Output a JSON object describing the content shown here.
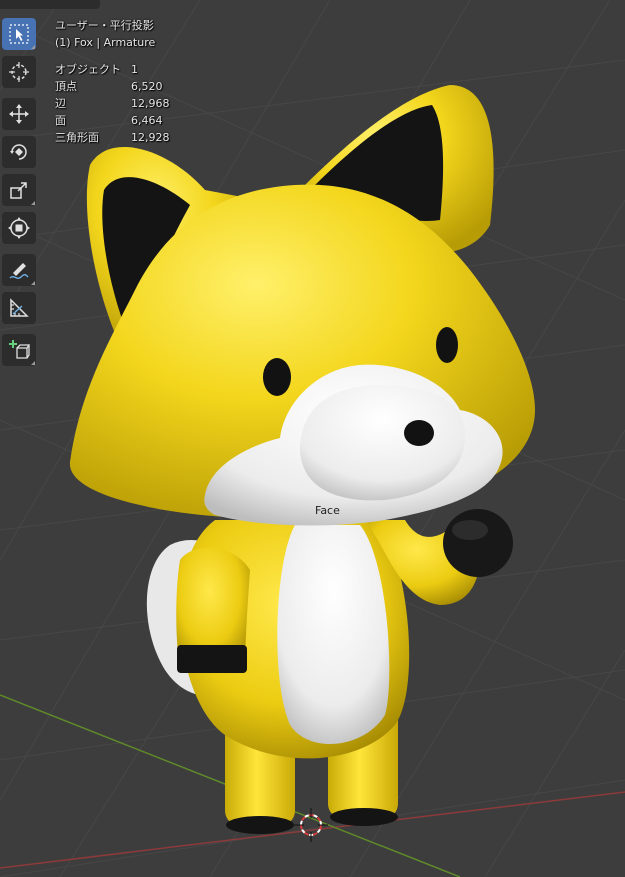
{
  "viewport": {
    "view_name": "ユーザー・平行投影",
    "collection_info": "(1) Fox | Armature",
    "object_name_label": "Face"
  },
  "stats": [
    {
      "label": "オブジェクト",
      "value": "1"
    },
    {
      "label": "頂点",
      "value": "6,520"
    },
    {
      "label": "辺",
      "value": "12,968"
    },
    {
      "label": "面",
      "value": "6,464"
    },
    {
      "label": "三角形面",
      "value": "12,928"
    }
  ],
  "toolbar": {
    "tools": [
      "select-box-icon",
      "cursor-icon",
      "move-icon",
      "rotate-icon",
      "scale-icon",
      "transform-icon",
      "annotate-icon",
      "measure-icon",
      "add-cube-icon"
    ],
    "active_tool": "select-box-icon"
  },
  "colors": {
    "background": "#3d3d3d",
    "fox_yellow": "#f2d21a",
    "fox_white": "#efefef",
    "fox_black": "#141414",
    "grid_x_axis": "#8c3a3a",
    "grid_y_axis": "#5f8a2a",
    "active_tool": "#4772b3"
  }
}
